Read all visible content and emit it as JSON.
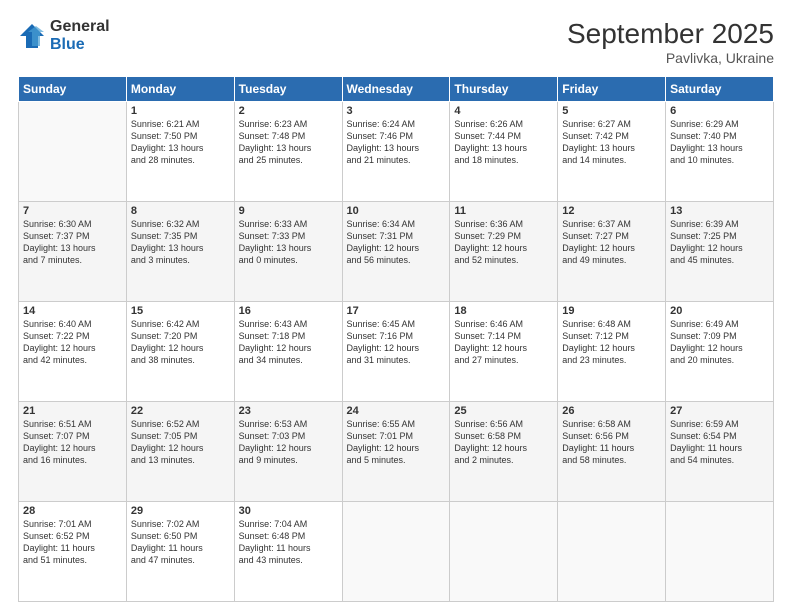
{
  "logo": {
    "general": "General",
    "blue": "Blue"
  },
  "header": {
    "month": "September 2025",
    "location": "Pavlivka, Ukraine"
  },
  "weekdays": [
    "Sunday",
    "Monday",
    "Tuesday",
    "Wednesday",
    "Thursday",
    "Friday",
    "Saturday"
  ],
  "weeks": [
    [
      {
        "day": "",
        "info": ""
      },
      {
        "day": "1",
        "info": "Sunrise: 6:21 AM\nSunset: 7:50 PM\nDaylight: 13 hours\nand 28 minutes."
      },
      {
        "day": "2",
        "info": "Sunrise: 6:23 AM\nSunset: 7:48 PM\nDaylight: 13 hours\nand 25 minutes."
      },
      {
        "day": "3",
        "info": "Sunrise: 6:24 AM\nSunset: 7:46 PM\nDaylight: 13 hours\nand 21 minutes."
      },
      {
        "day": "4",
        "info": "Sunrise: 6:26 AM\nSunset: 7:44 PM\nDaylight: 13 hours\nand 18 minutes."
      },
      {
        "day": "5",
        "info": "Sunrise: 6:27 AM\nSunset: 7:42 PM\nDaylight: 13 hours\nand 14 minutes."
      },
      {
        "day": "6",
        "info": "Sunrise: 6:29 AM\nSunset: 7:40 PM\nDaylight: 13 hours\nand 10 minutes."
      }
    ],
    [
      {
        "day": "7",
        "info": "Sunrise: 6:30 AM\nSunset: 7:37 PM\nDaylight: 13 hours\nand 7 minutes."
      },
      {
        "day": "8",
        "info": "Sunrise: 6:32 AM\nSunset: 7:35 PM\nDaylight: 13 hours\nand 3 minutes."
      },
      {
        "day": "9",
        "info": "Sunrise: 6:33 AM\nSunset: 7:33 PM\nDaylight: 13 hours\nand 0 minutes."
      },
      {
        "day": "10",
        "info": "Sunrise: 6:34 AM\nSunset: 7:31 PM\nDaylight: 12 hours\nand 56 minutes."
      },
      {
        "day": "11",
        "info": "Sunrise: 6:36 AM\nSunset: 7:29 PM\nDaylight: 12 hours\nand 52 minutes."
      },
      {
        "day": "12",
        "info": "Sunrise: 6:37 AM\nSunset: 7:27 PM\nDaylight: 12 hours\nand 49 minutes."
      },
      {
        "day": "13",
        "info": "Sunrise: 6:39 AM\nSunset: 7:25 PM\nDaylight: 12 hours\nand 45 minutes."
      }
    ],
    [
      {
        "day": "14",
        "info": "Sunrise: 6:40 AM\nSunset: 7:22 PM\nDaylight: 12 hours\nand 42 minutes."
      },
      {
        "day": "15",
        "info": "Sunrise: 6:42 AM\nSunset: 7:20 PM\nDaylight: 12 hours\nand 38 minutes."
      },
      {
        "day": "16",
        "info": "Sunrise: 6:43 AM\nSunset: 7:18 PM\nDaylight: 12 hours\nand 34 minutes."
      },
      {
        "day": "17",
        "info": "Sunrise: 6:45 AM\nSunset: 7:16 PM\nDaylight: 12 hours\nand 31 minutes."
      },
      {
        "day": "18",
        "info": "Sunrise: 6:46 AM\nSunset: 7:14 PM\nDaylight: 12 hours\nand 27 minutes."
      },
      {
        "day": "19",
        "info": "Sunrise: 6:48 AM\nSunset: 7:12 PM\nDaylight: 12 hours\nand 23 minutes."
      },
      {
        "day": "20",
        "info": "Sunrise: 6:49 AM\nSunset: 7:09 PM\nDaylight: 12 hours\nand 20 minutes."
      }
    ],
    [
      {
        "day": "21",
        "info": "Sunrise: 6:51 AM\nSunset: 7:07 PM\nDaylight: 12 hours\nand 16 minutes."
      },
      {
        "day": "22",
        "info": "Sunrise: 6:52 AM\nSunset: 7:05 PM\nDaylight: 12 hours\nand 13 minutes."
      },
      {
        "day": "23",
        "info": "Sunrise: 6:53 AM\nSunset: 7:03 PM\nDaylight: 12 hours\nand 9 minutes."
      },
      {
        "day": "24",
        "info": "Sunrise: 6:55 AM\nSunset: 7:01 PM\nDaylight: 12 hours\nand 5 minutes."
      },
      {
        "day": "25",
        "info": "Sunrise: 6:56 AM\nSunset: 6:58 PM\nDaylight: 12 hours\nand 2 minutes."
      },
      {
        "day": "26",
        "info": "Sunrise: 6:58 AM\nSunset: 6:56 PM\nDaylight: 11 hours\nand 58 minutes."
      },
      {
        "day": "27",
        "info": "Sunrise: 6:59 AM\nSunset: 6:54 PM\nDaylight: 11 hours\nand 54 minutes."
      }
    ],
    [
      {
        "day": "28",
        "info": "Sunrise: 7:01 AM\nSunset: 6:52 PM\nDaylight: 11 hours\nand 51 minutes."
      },
      {
        "day": "29",
        "info": "Sunrise: 7:02 AM\nSunset: 6:50 PM\nDaylight: 11 hours\nand 47 minutes."
      },
      {
        "day": "30",
        "info": "Sunrise: 7:04 AM\nSunset: 6:48 PM\nDaylight: 11 hours\nand 43 minutes."
      },
      {
        "day": "",
        "info": ""
      },
      {
        "day": "",
        "info": ""
      },
      {
        "day": "",
        "info": ""
      },
      {
        "day": "",
        "info": ""
      }
    ]
  ]
}
